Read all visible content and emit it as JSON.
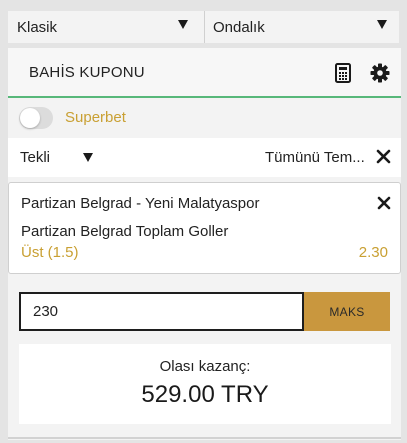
{
  "odds_format": {
    "left_select": "Klasik",
    "right_select": "Ondalık"
  },
  "coupon": {
    "title": "BAHİS KUPONU",
    "calculator_icon": "calculator-icon",
    "settings_icon": "gear-icon",
    "accent_color": "#58b87a"
  },
  "superbet": {
    "label": "Superbet",
    "enabled": false,
    "label_color": "#c9a033"
  },
  "bet_type": {
    "selected": "Tekli",
    "clear_all": "Tümünü Tem..."
  },
  "bet": {
    "match": "Partizan Belgrad - Yeni Malatyaspor",
    "market": "Partizan Belgrad Toplam Goller",
    "selection": "Üst (1.5)",
    "odds": "2.30"
  },
  "stake": {
    "value": "230",
    "max_label": "MAKS",
    "max_color": "#c9973e"
  },
  "potential_win": {
    "label": "Olası kazanç:",
    "amount": "529.00 TRY"
  }
}
